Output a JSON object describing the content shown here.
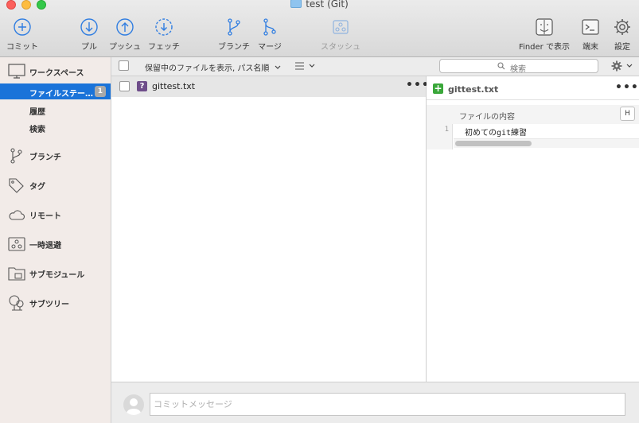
{
  "window": {
    "title": "test (Git)"
  },
  "toolbar": {
    "commit": "コミット",
    "pull": "プル",
    "push": "プッシュ",
    "fetch": "フェッチ",
    "branch": "ブランチ",
    "merge": "マージ",
    "stash": "スタッシュ",
    "finder": "Finder で表示",
    "terminal": "端末",
    "settings": "設定"
  },
  "sidebar": {
    "workspace": "ワークスペース",
    "file_status": "ファイルステー…",
    "file_status_count": "1",
    "history": "履歴",
    "search": "検索",
    "branches": "ブランチ",
    "tags": "タグ",
    "remotes": "リモート",
    "stashes": "一時退避",
    "submodules": "サブモジュール",
    "subtrees": "サブツリー"
  },
  "filter": {
    "label": "保留中のファイルを表示, パス名順",
    "search_placeholder": "検索"
  },
  "files": [
    {
      "name": "gittest.txt",
      "status": "?"
    }
  ],
  "diff": {
    "file_name": "gittest.txt",
    "hunk_title": "ファイルの内容",
    "hunk_button": "H",
    "lines": [
      {
        "number": "1",
        "text": "初めてのgit練習"
      }
    ]
  },
  "commit": {
    "placeholder": "コミットメッセージ"
  },
  "colors": {
    "accent": "#1a73d9",
    "added": "#3aa73a",
    "untracked": "#6e4d8a"
  }
}
